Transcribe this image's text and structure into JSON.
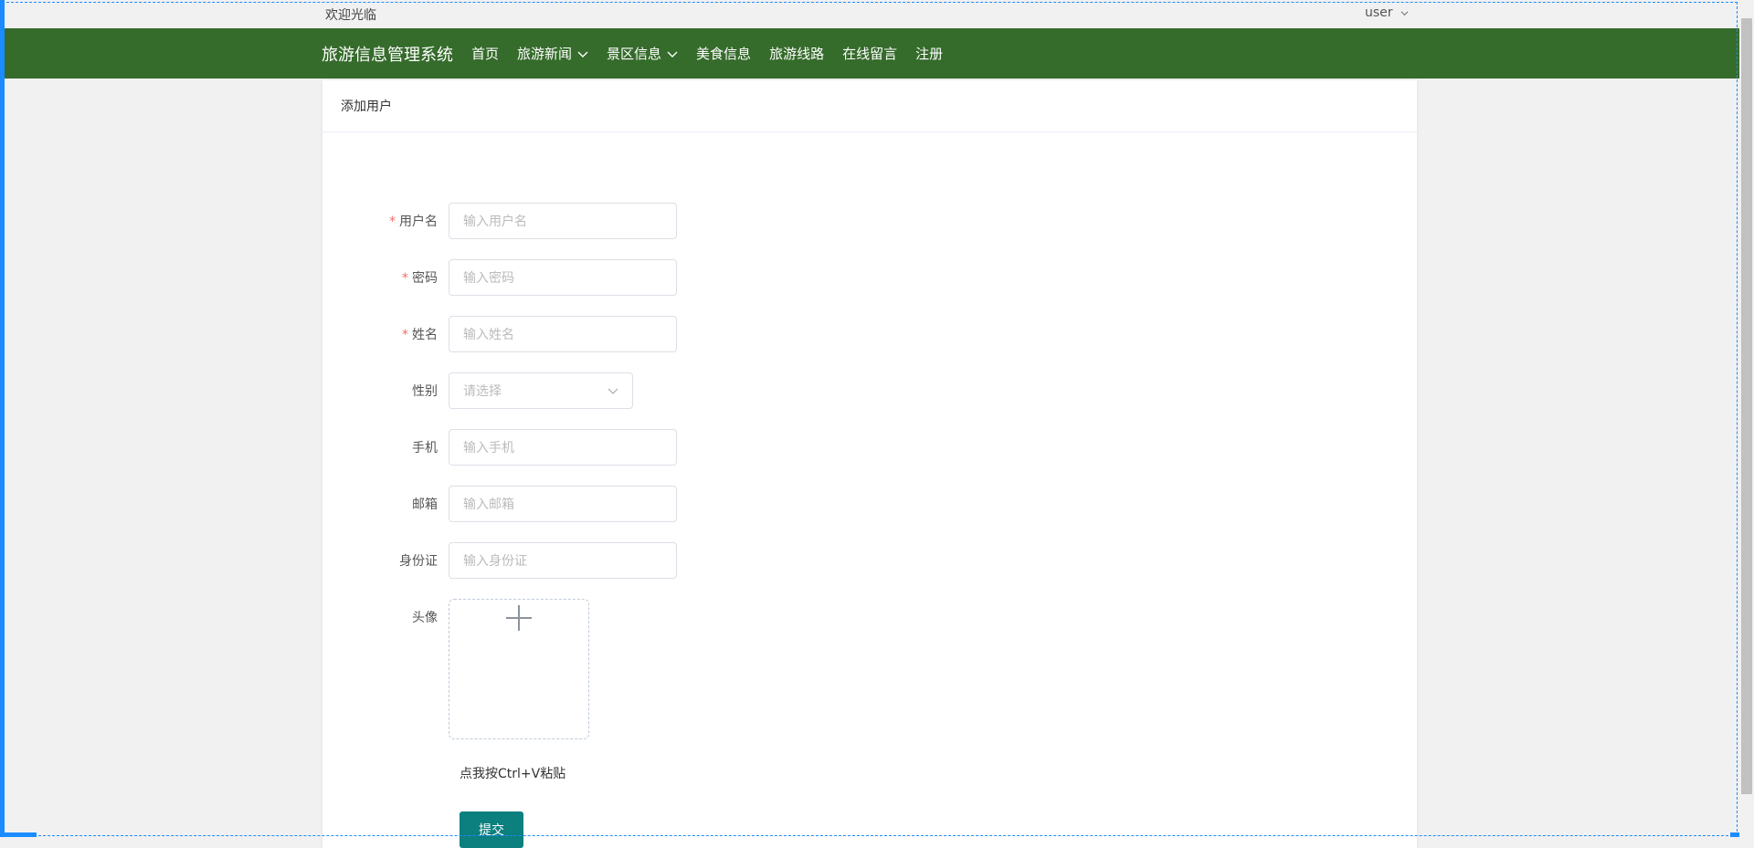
{
  "topbar": {
    "welcome": "欢迎光临",
    "user": "user"
  },
  "nav": {
    "brand": "旅游信息管理系统",
    "items": [
      {
        "label": "首页",
        "dropdown": false
      },
      {
        "label": "旅游新闻",
        "dropdown": true
      },
      {
        "label": "景区信息",
        "dropdown": true
      },
      {
        "label": "美食信息",
        "dropdown": false
      },
      {
        "label": "旅游线路",
        "dropdown": false
      },
      {
        "label": "在线留言",
        "dropdown": false
      },
      {
        "label": "注册",
        "dropdown": false
      }
    ]
  },
  "card": {
    "title": "添加用户"
  },
  "form": {
    "username": {
      "label": "用户名",
      "required": true,
      "placeholder": "输入用户名"
    },
    "password": {
      "label": "密码",
      "required": true,
      "placeholder": "输入密码"
    },
    "name": {
      "label": "姓名",
      "required": true,
      "placeholder": "输入姓名"
    },
    "gender": {
      "label": "性别",
      "placeholder": "请选择"
    },
    "phone": {
      "label": "手机",
      "placeholder": "输入手机"
    },
    "email": {
      "label": "邮箱",
      "placeholder": "输入邮箱"
    },
    "idcard": {
      "label": "身份证",
      "placeholder": "输入身份证"
    },
    "avatar": {
      "label": "头像"
    },
    "paste_hint": "点我按Ctrl+V粘贴",
    "submit": "提交"
  },
  "colors": {
    "nav_bg": "#356b2b",
    "submit_bg": "#0c7f7f",
    "required": "#f56c6c"
  }
}
